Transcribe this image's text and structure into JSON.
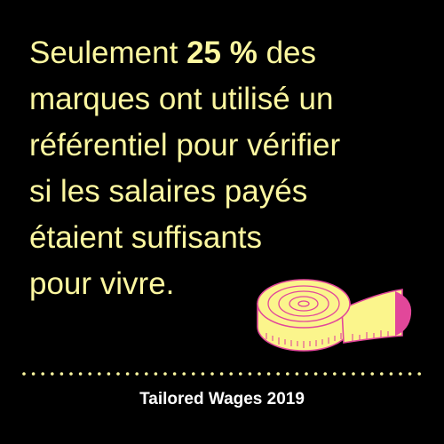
{
  "colors": {
    "background": "#000000",
    "headline_text": "#fcf7a0",
    "source_text": "#ffffff",
    "divider_dots": "#fcf7a0",
    "tape_fill": "#fbf58c",
    "tape_accent": "#e2479a"
  },
  "headline": {
    "line1": {
      "before": "Seulement ",
      "highlight": "25 %",
      "after": " des"
    },
    "line2": "marques ont utilisé un",
    "line3": "référentiel pour vérifier",
    "line4": "si les salaires payés",
    "line5": "étaient suffisants",
    "line6": "pour vivre."
  },
  "illustration": {
    "icon": "measuring-tape-icon"
  },
  "footer": {
    "source": "Tailored Wages 2019"
  }
}
